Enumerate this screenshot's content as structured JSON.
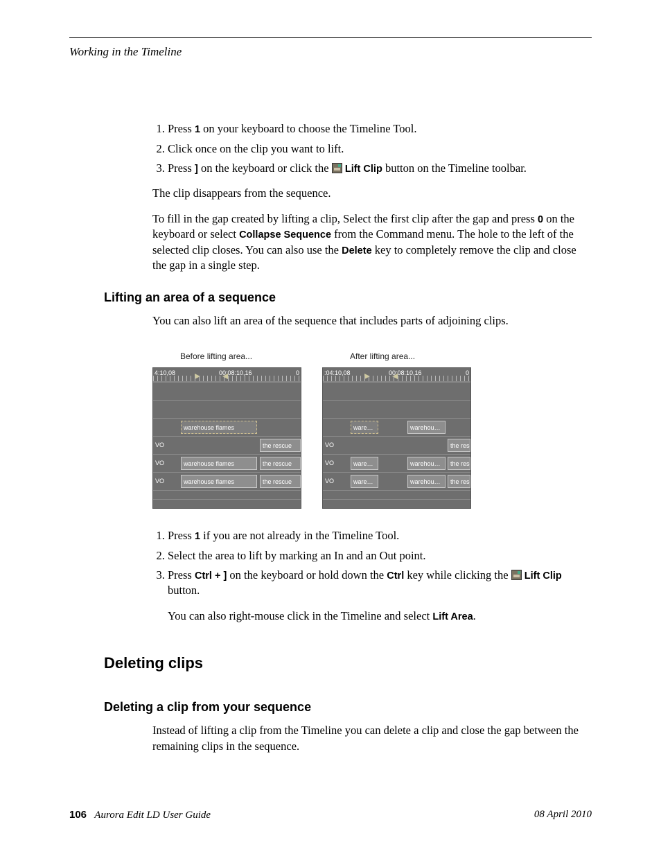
{
  "running_head": "Working in the Timeline",
  "intro_list": {
    "i1a": "Press ",
    "i1key": "1",
    "i1b": " on your keyboard to choose the Timeline Tool.",
    "i2": "Click once on the clip you want to lift.",
    "i3a": "Press ",
    "i3key": "]",
    "i3b": " on the keyboard or click the ",
    "i3btn": "Lift Clip",
    "i3c": " button on the Timeline toolbar."
  },
  "p_disappear": "The clip disappears from the sequence.",
  "p_fill_a": "To fill in the gap created by lifting a clip, Select the first clip after the gap and press ",
  "p_fill_key0": "0",
  "p_fill_b": " on the keyboard or select ",
  "p_fill_collapse": "Collapse Sequence",
  "p_fill_c": " from the Command menu. The hole to the left of the selected clip closes. You can also use the ",
  "p_fill_delete": "Delete",
  "p_fill_d": " key to completely remove the clip and close the gap in a single step.",
  "h2_lift": "Lifting an area of a sequence",
  "p_lift_intro": "You can also lift an area of the sequence that includes parts of adjoining clips.",
  "fig": {
    "before_cap": "Before lifting area...",
    "after_cap": "After lifting area...",
    "tc1": "4:10,08",
    "tc2": "00:08:10,16",
    "tc1b": ":04:10,08",
    "tc2b": "00:08:10,16",
    "tcend": "0",
    "vo": "VO",
    "wh_full": "warehouse flames",
    "rescue": "the rescue",
    "ware": "ware…",
    "warehou": "warehou…"
  },
  "lift_list": {
    "l1a": "Press ",
    "l1key": "1",
    "l1b": " if you are not already in the Timeline Tool.",
    "l2": "Select the area to lift by marking an In and an Out point.",
    "l3a": "Press ",
    "l3key1": "Ctrl + ]",
    "l3b": " on the keyboard or hold down the ",
    "l3key2": "Ctrl",
    "l3c": " key while clicking the ",
    "l3btn": "Lift Clip",
    "l3d": " button."
  },
  "p_rightclick_a": "You can also right-mouse click in the Timeline and select ",
  "p_rightclick_b": "Lift Area",
  "p_rightclick_c": ".",
  "h1_delete": "Deleting clips",
  "h2_delete_clip": "Deleting a clip from your sequence",
  "p_delete_intro": "Instead of lifting a clip from the Timeline you can delete a clip and close the gap between the remaining clips in the sequence.",
  "footer": {
    "page": "106",
    "guide": "Aurora Edit LD User Guide",
    "date": "08 April 2010"
  }
}
